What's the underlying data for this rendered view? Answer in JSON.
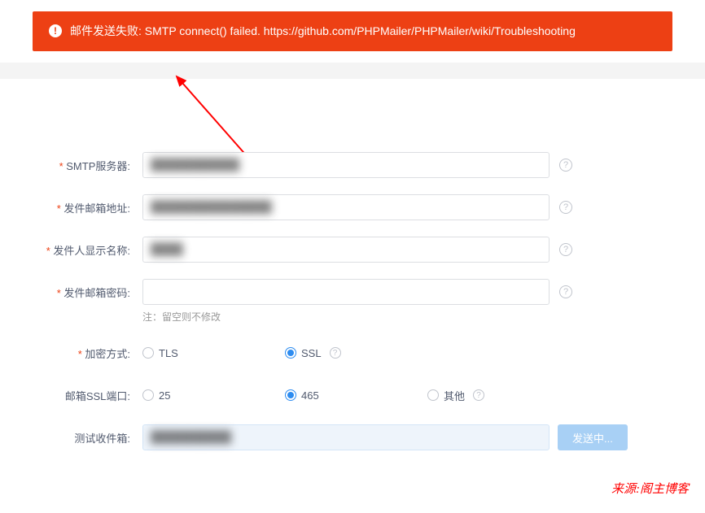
{
  "error": {
    "message": "邮件发送失败: SMTP connect() failed. https://github.com/PHPMailer/PHPMailer/wiki/Troubleshooting"
  },
  "form": {
    "smtp_server": {
      "label": "SMTP服务器:",
      "value": "███████████"
    },
    "sender_addr": {
      "label": "发件邮箱地址:",
      "value": "███████████████"
    },
    "sender_name": {
      "label": "发件人显示名称:",
      "value": "████"
    },
    "sender_pass": {
      "label": "发件邮箱密码:",
      "value": "",
      "hint": "注：留空则不修改"
    },
    "encrypt": {
      "label": "加密方式:",
      "options": [
        {
          "label": "TLS",
          "checked": false,
          "help": false
        },
        {
          "label": "SSL",
          "checked": true,
          "help": true
        }
      ]
    },
    "port": {
      "label": "邮箱SSL端口:",
      "options": [
        {
          "label": "25",
          "checked": false,
          "help": false
        },
        {
          "label": "465",
          "checked": true,
          "help": false
        },
        {
          "label": "其他",
          "checked": false,
          "help": true
        }
      ]
    },
    "test": {
      "label": "测试收件箱:",
      "value": "██████████",
      "button": "发送中..."
    }
  },
  "watermark": "来源:阁主博客"
}
